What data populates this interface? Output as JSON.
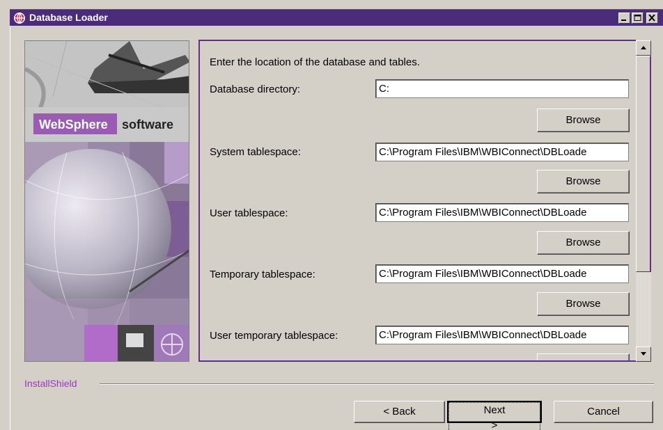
{
  "window": {
    "title": "Database Loader",
    "icon": "globe-icon",
    "controls": [
      "minimize-icon",
      "maximize-icon",
      "close-icon"
    ],
    "accent_color": "#4b2c7a"
  },
  "banner": {
    "brand_name": "WebSphere",
    "brand_suffix": "software"
  },
  "panel": {
    "intro": "Enter the location of the database and tables.",
    "fields": [
      {
        "label": "Database directory:",
        "value": "C:"
      },
      {
        "label": "System tablespace:",
        "value": "C:\\Program Files\\IBM\\WBIConnect\\DBLoade"
      },
      {
        "label": "User tablespace:",
        "value": "C:\\Program Files\\IBM\\WBIConnect\\DBLoade"
      },
      {
        "label": "Temporary tablespace:",
        "value": "C:\\Program Files\\IBM\\WBIConnect\\DBLoade"
      },
      {
        "label": "User temporary tablespace:",
        "value": "C:\\Program Files\\IBM\\WBIConnect\\DBLoade"
      }
    ],
    "browse_label": "Browse"
  },
  "footer": {
    "brand": "InstallShield",
    "back_label": "< Back",
    "next_label": "Next >",
    "cancel_label": "Cancel"
  }
}
